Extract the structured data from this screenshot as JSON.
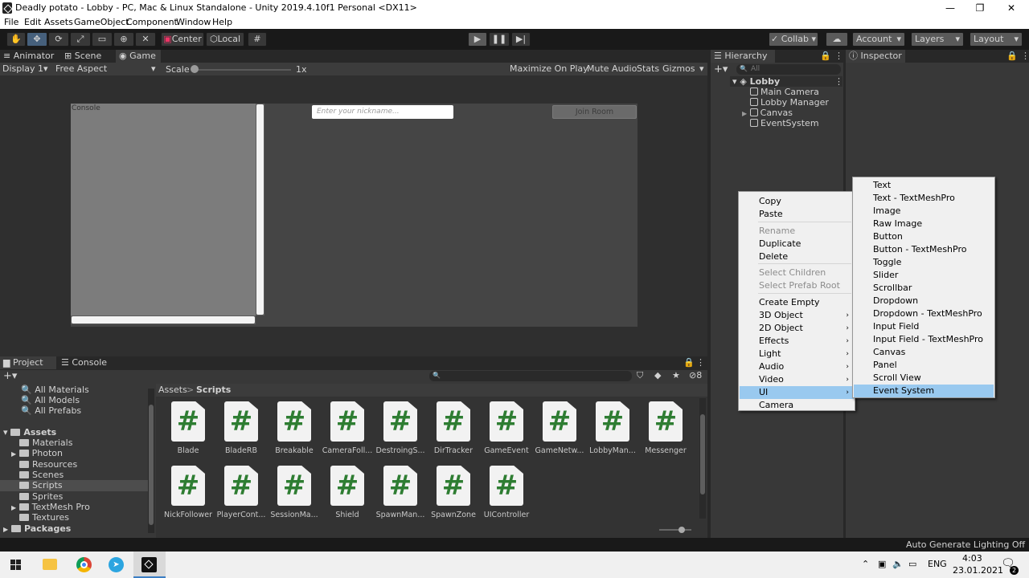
{
  "window": {
    "title": "Deadly potato - Lobby - PC, Mac & Linux Standalone - Unity 2019.4.10f1 Personal <DX11>",
    "minimize": "—",
    "maximize": "❐",
    "close": "✕"
  },
  "menu": [
    "File",
    "Edit",
    "Assets",
    "GameObject",
    "Component",
    "Window",
    "Help"
  ],
  "toolbar": {
    "center": "Center",
    "local": "Local",
    "collab": "Collab ▾",
    "account": "Account",
    "layers": "Layers",
    "layout": "Layout"
  },
  "game_tabs": {
    "animator": "Animator",
    "scene": "Scene",
    "game": "Game"
  },
  "game_ctrl": {
    "display": "Display 1",
    "aspect": "Free Aspect",
    "scale_label": "Scale",
    "scale_value": "1x",
    "maximize": "Maximize On Play",
    "mute": "Mute Audio",
    "stats": "Stats",
    "gizmos": "Gizmos"
  },
  "game_view": {
    "console_label": "Console",
    "nickname_placeholder": "Enter your nickname...",
    "join_button": "Join Room"
  },
  "hierarchy": {
    "tab": "Hierarchy",
    "search_placeholder": "All",
    "scene": "Lobby",
    "items": [
      "Main Camera",
      "Lobby Manager",
      "Canvas",
      "EventSystem"
    ]
  },
  "inspector": {
    "tab": "Inspector"
  },
  "context_menu": {
    "items": [
      {
        "label": "Copy",
        "disabled": false
      },
      {
        "label": "Paste",
        "disabled": false
      },
      {
        "label": "Rename",
        "disabled": true
      },
      {
        "label": "Duplicate",
        "disabled": false
      },
      {
        "label": "Delete",
        "disabled": false
      },
      {
        "label": "Select Children",
        "disabled": true
      },
      {
        "label": "Select Prefab Root",
        "disabled": true
      },
      {
        "label": "Create Empty",
        "disabled": false
      },
      {
        "label": "3D Object",
        "disabled": false,
        "submenu": true
      },
      {
        "label": "2D Object",
        "disabled": false,
        "submenu": true
      },
      {
        "label": "Effects",
        "disabled": false,
        "submenu": true
      },
      {
        "label": "Light",
        "disabled": false,
        "submenu": true
      },
      {
        "label": "Audio",
        "disabled": false,
        "submenu": true
      },
      {
        "label": "Video",
        "disabled": false,
        "submenu": true
      },
      {
        "label": "UI",
        "disabled": false,
        "submenu": true,
        "highlighted": true
      },
      {
        "label": "Camera",
        "disabled": false
      }
    ]
  },
  "ui_submenu": {
    "items": [
      "Text",
      "Text - TextMeshPro",
      "Image",
      "Raw Image",
      "Button",
      "Button - TextMeshPro",
      "Toggle",
      "Slider",
      "Scrollbar",
      "Dropdown",
      "Dropdown - TextMeshPro",
      "Input Field",
      "Input Field - TextMeshPro",
      "Canvas",
      "Panel",
      "Scroll View",
      "Event System"
    ],
    "highlighted": "Event System"
  },
  "project": {
    "tabs": {
      "project": "Project",
      "console": "Console"
    },
    "hidden_count": "8",
    "favorites": [
      "All Materials",
      "All Models",
      "All Prefabs"
    ],
    "root": "Assets",
    "folders": [
      "Materials",
      "Photon",
      "Resources",
      "Scenes",
      "Scripts",
      "Sprites",
      "TextMesh Pro",
      "Textures"
    ],
    "selected_folder": "Scripts",
    "packages": "Packages",
    "breadcrumb": {
      "root": "Assets",
      "sep": ">",
      "current": "Scripts"
    },
    "assets": [
      "Blade",
      "BladeRB",
      "Breakable",
      "CameraFoll...",
      "DestroingS...",
      "DirTracker",
      "GameEvent",
      "GameNetw...",
      "LobbyMan...",
      "Messenger",
      "NickFollower",
      "PlayerCont...",
      "SessionMa...",
      "Shield",
      "SpawnMan...",
      "SpawnZone",
      "UIController"
    ]
  },
  "status": {
    "text": "Auto Generate Lighting Off"
  },
  "taskbar": {
    "lang": "ENG",
    "time": "4:03",
    "date": "23.01.2021",
    "notif_count": "2"
  }
}
